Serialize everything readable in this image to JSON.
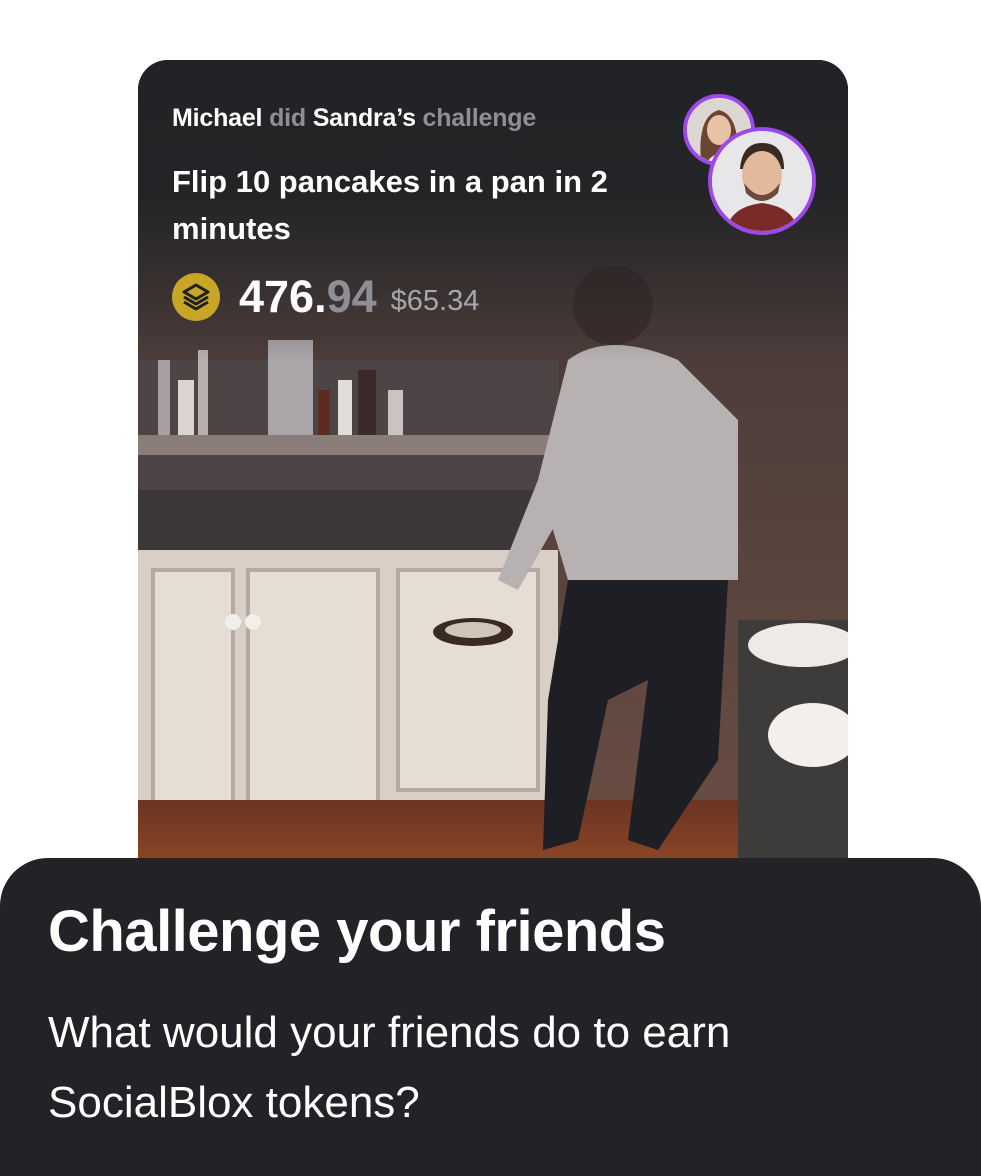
{
  "challenge_card": {
    "performer": "Michael",
    "did_word": "did",
    "challenger": "Sandra’s",
    "challenge_word": "challenge",
    "title": "Flip 10 pancakes in a pan in 2 minutes",
    "token_amount_int": "476.",
    "token_amount_dec": "94",
    "fiat_amount": "$65.34",
    "token_icon": "socialblox-token-icon",
    "avatars": [
      {
        "name": "Sandra",
        "icon": "sandra-avatar"
      },
      {
        "name": "Michael",
        "icon": "michael-avatar"
      }
    ]
  },
  "promo": {
    "headline": "Challenge your friends",
    "description": "What would your friends do to earn SocialBlox tokens?"
  },
  "colors": {
    "accent": "#9c48ea",
    "token_gold": "#c8a526",
    "panel_bg": "#222326",
    "muted_text": "#8e8f95"
  }
}
